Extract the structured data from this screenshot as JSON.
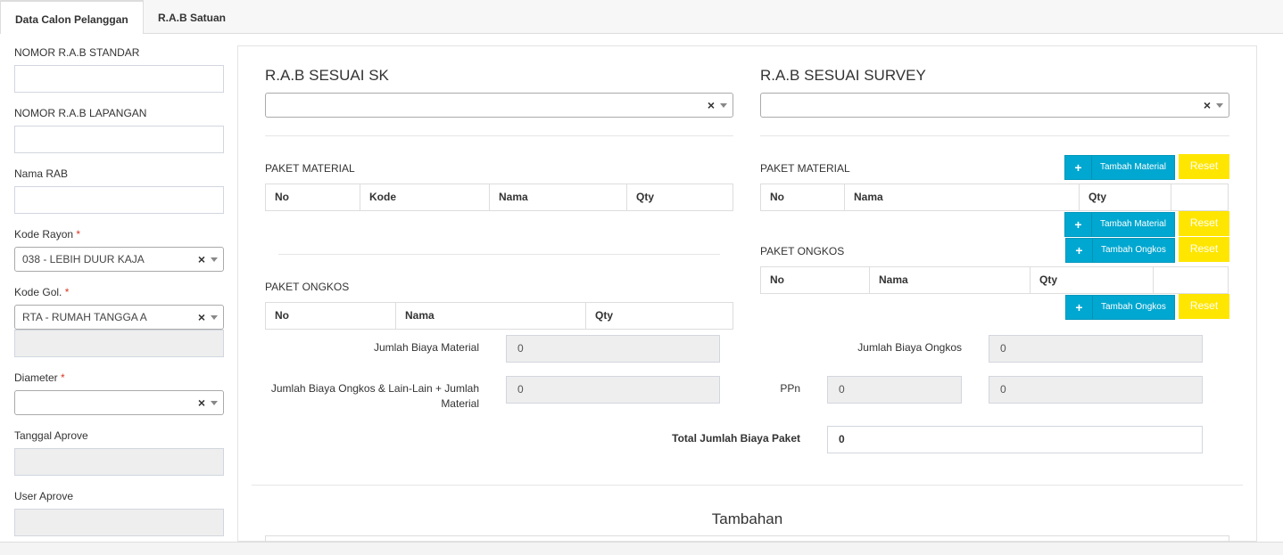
{
  "tabs": [
    {
      "label": "Data Calon Pelanggan",
      "active": true
    },
    {
      "label": "R.A.B Satuan",
      "active": false
    }
  ],
  "form": {
    "nomor_rab_standar": {
      "label": "NOMOR R.A.B STANDAR",
      "value": ""
    },
    "nomor_rab_lapangan": {
      "label": "NOMOR R.A.B LAPANGAN",
      "value": ""
    },
    "nama_rab": {
      "label": "Nama RAB",
      "value": ""
    },
    "kode_rayon": {
      "label": "Kode Rayon",
      "required": "*",
      "value": "038 - LEBIH DUUR KAJA"
    },
    "kode_gol": {
      "label": "Kode Gol.",
      "required": "*",
      "value": "RTA - RUMAH TANGGA A",
      "extra_value": ""
    },
    "diameter": {
      "label": "Diameter",
      "required": "*",
      "value": ""
    },
    "tanggal_aprove": {
      "label": "Tanggal Aprove",
      "value": ""
    },
    "user_aprove": {
      "label": "User Aprove",
      "value": ""
    }
  },
  "sk": {
    "title": "R.A.B SESUAI SK",
    "select_value": "",
    "material": {
      "title": "PAKET MATERIAL",
      "columns": [
        "No",
        "Kode",
        "Nama",
        "Qty"
      ]
    },
    "ongkos": {
      "title": "PAKET ONGKOS",
      "columns": [
        "No",
        "Nama",
        "Qty"
      ]
    }
  },
  "survey": {
    "title": "R.A.B SESUAI SURVEY",
    "select_value": "",
    "material": {
      "title": "PAKET MATERIAL",
      "columns": [
        "No",
        "Nama",
        "Qty",
        ""
      ]
    },
    "ongkos": {
      "title": "PAKET ONGKOS",
      "columns": [
        "No",
        "Nama",
        "Qty",
        ""
      ]
    }
  },
  "buttons": {
    "tambah_material": "Tambah Material",
    "tambah_ongkos": "Tambah Ongkos",
    "reset": "Reset",
    "plus": "+"
  },
  "totals": {
    "jumlah_biaya_material": {
      "label": "Jumlah Biaya Material",
      "value": "0"
    },
    "jumlah_biaya_ongkos": {
      "label": "Jumlah Biaya Ongkos",
      "value": "0"
    },
    "jumlah_ongkos_lain": {
      "label": "Jumlah Biaya Ongkos & Lain-Lain + Jumlah Material",
      "value": "0"
    },
    "ppn": {
      "label": "PPn",
      "value": "0",
      "value2": "0"
    },
    "total": {
      "label": "Total Jumlah Biaya Paket",
      "value": "0"
    }
  },
  "tambahan": {
    "title": "Tambahan"
  },
  "clear_glyph": "×",
  "colors": {
    "accent_blue": "#00a7d0",
    "accent_yellow": "#ffe600",
    "required": "#d73925"
  }
}
